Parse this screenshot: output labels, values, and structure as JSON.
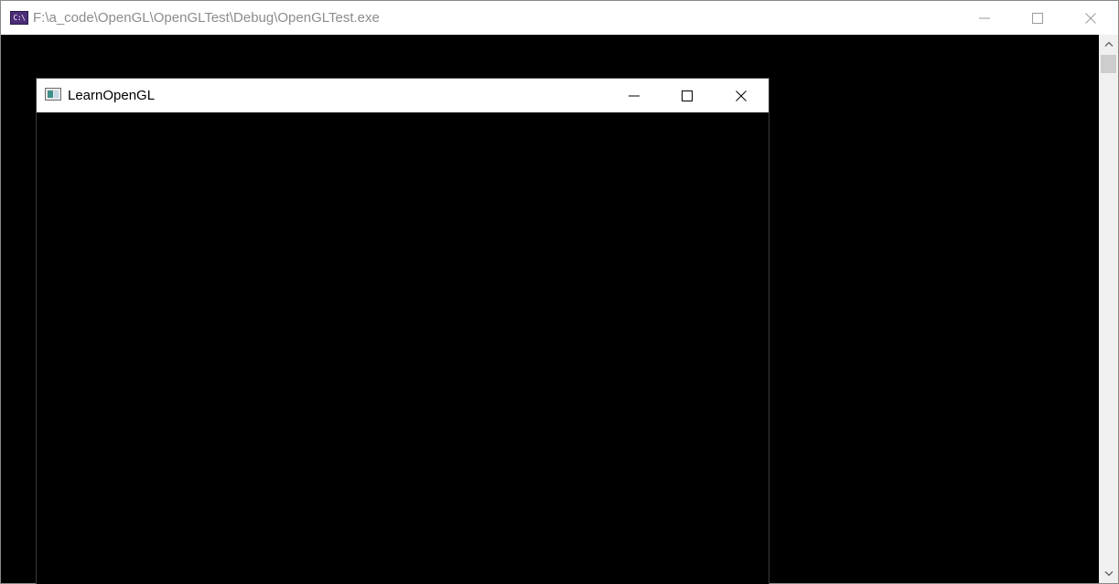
{
  "console_window": {
    "title": "F:\\a_code\\OpenGL\\OpenGLTest\\Debug\\OpenGLTest.exe",
    "icon_text": "C:\\",
    "icon": "console-icon",
    "minimize_icon": "minimize-icon",
    "maximize_icon": "maximize-icon",
    "close_icon": "close-icon",
    "background_color": "#000000"
  },
  "scrollbar": {
    "up_icon": "chevron-up-icon",
    "down_icon": "chevron-down-icon"
  },
  "gl_window": {
    "title": "LearnOpenGL",
    "icon": "window-app-icon",
    "minimize_icon": "minimize-icon",
    "maximize_icon": "maximize-icon",
    "close_icon": "close-icon",
    "background_color": "#000000"
  }
}
